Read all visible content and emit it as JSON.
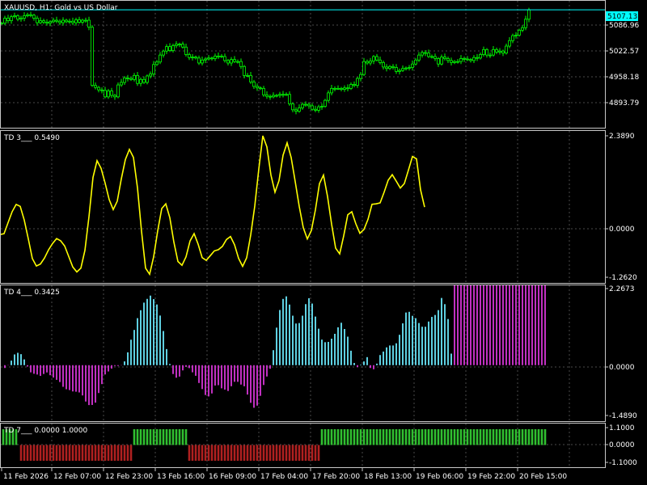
{
  "main_panel": {
    "label": "XAUUSD, H1:  Gold vs US Dollar",
    "price_labels": [
      "5086.96",
      "5022.57",
      "4958.18",
      "4893.79"
    ],
    "current_price": "5107.13",
    "current_price_color": "#00ffff",
    "candle_color": "#00ff00"
  },
  "td3_panel": {
    "label": "TD 3___  0.5490",
    "scale_labels": [
      "2.3890",
      "0.0000",
      "-1.2620"
    ],
    "line_color": "#ffff00"
  },
  "td4_panel": {
    "label": "TD 4___  0.3425",
    "scale_labels": [
      "2.2673",
      "0.0000",
      "-1.4890"
    ],
    "positive_color": "#5ecfe0",
    "negative_color": "#c030c0"
  },
  "td7_panel": {
    "label": "TD 7___  0.0000 1.0000",
    "scale_labels": [
      "1.1000",
      "0.0000",
      "-1.1000"
    ],
    "positive_color": "#30c030",
    "negative_color": "#b02020"
  },
  "time_labels": [
    "11 Feb 2026",
    "12 Feb 07:00",
    "12 Feb 23:00",
    "13 Feb 16:00",
    "16 Feb 09:00",
    "17 Feb 04:00",
    "17 Feb 20:00",
    "18 Feb 13:00",
    "19 Feb 06:00",
    "19 Feb 22:00",
    "20 Feb 15:00"
  ],
  "chart_data": {
    "type": "line",
    "symbol": "XAUUSD",
    "timeframe": "H1",
    "price_ylim": [
      4870,
      5125
    ],
    "price": {
      "x": [
        2,
        6,
        10,
        14,
        18,
        22,
        26,
        30,
        34,
        38,
        42,
        46,
        50,
        54,
        58,
        62,
        66,
        70,
        74,
        78,
        82,
        86,
        90,
        94,
        98,
        102,
        106,
        110,
        114,
        118,
        122,
        126,
        130,
        134,
        138,
        142,
        146,
        150,
        154,
        158,
        162,
        166,
        170,
        174,
        178,
        182,
        186,
        190,
        194,
        198,
        202,
        206,
        210,
        214,
        218,
        222,
        226,
        230,
        234,
        238,
        242,
        246,
        250,
        254,
        258,
        262,
        266,
        270,
        274,
        278,
        282,
        286,
        290,
        294,
        298,
        302,
        306,
        310,
        314,
        318,
        322,
        326,
        330,
        334,
        338,
        342,
        346,
        350,
        354,
        358,
        362,
        366,
        370,
        374,
        378,
        382,
        386,
        390,
        394,
        398,
        402,
        406,
        410,
        414,
        418,
        422,
        426,
        430,
        434,
        438,
        442,
        446,
        450,
        454,
        458,
        462,
        466,
        470,
        474,
        478,
        482,
        486,
        490,
        494,
        498,
        502,
        506,
        510,
        514,
        518,
        522,
        526,
        530,
        534,
        538,
        542,
        546,
        550,
        554,
        558,
        562,
        566,
        570,
        574,
        578,
        582,
        586,
        590,
        594,
        598,
        602,
        606,
        610,
        614,
        618,
        622,
        626,
        630,
        634,
        638,
        642,
        646,
        650,
        654,
        658,
        662,
        666,
        670,
        674
      ],
      "y": [
        5080,
        5090,
        5085,
        5093,
        5095,
        5088,
        5090,
        5095,
        5097,
        5096,
        5090,
        5081,
        5085,
        5082,
        5080,
        5083,
        5086,
        5084,
        5081,
        5086,
        5083,
        5084,
        5081,
        5087,
        5082,
        5086,
        5086,
        5072,
        4955,
        4951,
        4946,
        4945,
        4932,
        4944,
        4935,
        4932,
        4956,
        4961,
        4970,
        4969,
        4967,
        4975,
        4959,
        4967,
        4961,
        4974,
        4978,
        4997,
        5002,
        5016,
        5024,
        5033,
        5025,
        5035,
        5038,
        5038,
        5032,
        5017,
        5011,
        5012,
        5010,
        5000,
        5006,
        5008,
        5010,
        5009,
        5014,
        5014,
        5013,
        5005,
        5000,
        5007,
        5003,
        5003,
        4993,
        4975,
        4975,
        4962,
        4953,
        4950,
        4949,
        4936,
        4933,
        4932,
        4935,
        4935,
        4937,
        4937,
        4937,
        4918,
        4906,
        4903,
        4910,
        4917,
        4917,
        4914,
        4907,
        4905,
        4912,
        4913,
        4925,
        4940,
        4949,
        4949,
        4949,
        4947,
        4950,
        4949,
        4957,
        4955,
        4969,
        4977,
        5003,
        5000,
        5004,
        5013,
        5006,
        5001,
        4992,
        4989,
        4993,
        4991,
        4983,
        4985,
        4989,
        4990,
        4991,
        4998,
        5006,
        5016,
        5021,
        5020,
        5013,
        5013,
        5009,
        4998,
        5012,
        5009,
        5005,
        5001,
        5003,
        5003,
        5009,
        5008,
        5007,
        5005,
        5011,
        5010,
        5017,
        5027,
        5016,
        5016,
        5027,
        5022,
        5024,
        5020,
        5034,
        5045,
        5055,
        5056,
        5066,
        5071,
        5088,
        5107
      ]
    },
    "td3": {
      "ylim": [
        -1.262,
        2.389
      ],
      "x": [
        0,
        5,
        10,
        15,
        20,
        25,
        30,
        35,
        40,
        45,
        50,
        55,
        60,
        65,
        70,
        75,
        80,
        85,
        90,
        95,
        100,
        105,
        110,
        115,
        120,
        125,
        130,
        135,
        140,
        145,
        150,
        155,
        160,
        165,
        170,
        175,
        180,
        185,
        190,
        195,
        200,
        205,
        210,
        215,
        220,
        225,
        230,
        235,
        240,
        245,
        250,
        255,
        260,
        265,
        270,
        275,
        280,
        285,
        290,
        295,
        300,
        305,
        310,
        315,
        320,
        325,
        330,
        335,
        340,
        345,
        350,
        355,
        360,
        365,
        370,
        375,
        380,
        385,
        390,
        395,
        400,
        405,
        410,
        415,
        420,
        425,
        430,
        435,
        440,
        445,
        450,
        455,
        460,
        465,
        470,
        475,
        480,
        485,
        490,
        495,
        500,
        505,
        510,
        515,
        520,
        525,
        530,
        535,
        540,
        545,
        550,
        555,
        560,
        565,
        570,
        575,
        580,
        585,
        590,
        595,
        600,
        605,
        610,
        615,
        620,
        625,
        630,
        635,
        640,
        645,
        650,
        655,
        660,
        665,
        670,
        675
      ],
      "y": [
        -0.16,
        -0.138,
        0.148,
        0.429,
        0.617,
        0.568,
        0.213,
        -0.27,
        -0.781,
        -0.972,
        -0.919,
        -0.766,
        -0.555,
        -0.39,
        -0.263,
        -0.322,
        -0.456,
        -0.728,
        -0.996,
        -1.125,
        -1.027,
        -0.568,
        0.299,
        1.316,
        1.747,
        1.549,
        1.166,
        0.743,
        0.484,
        0.703,
        1.277,
        1.776,
        2.039,
        1.83,
        1.044,
        -0.077,
        -1.026,
        -1.185,
        -0.733,
        -0.062,
        0.511,
        0.633,
        0.274,
        -0.357,
        -0.855,
        -0.954,
        -0.734,
        -0.326,
        -0.136,
        -0.408,
        -0.758,
        -0.826,
        -0.706,
        -0.581,
        -0.551,
        -0.465,
        -0.288,
        -0.211,
        -0.424,
        -0.774,
        -0.981,
        -0.759,
        -0.169,
        0.573,
        1.532,
        2.389,
        2.103,
        1.378,
        0.932,
        1.233,
        1.889,
        2.207,
        1.829,
        1.21,
        0.566,
        0.017,
        -0.273,
        -0.055,
        0.479,
        1.154,
        1.376,
        0.823,
        0.108,
        -0.509,
        -0.659,
        -0.191,
        0.351,
        0.429,
        0.117,
        -0.127,
        -0.029,
        0.231,
        0.621,
        0.632,
        0.658,
        0.936,
        1.244,
        1.385,
        1.216,
        1.039,
        1.159,
        1.502,
        1.854,
        1.795,
        0.998,
        0.549
      ]
    },
    "td4": {
      "ylim": [
        -1.489,
        2.2673
      ],
      "x": [
        6,
        10,
        14,
        18,
        22,
        26,
        30,
        34,
        38,
        42,
        46,
        50,
        54,
        58,
        62,
        66,
        70,
        74,
        78,
        82,
        86,
        90,
        94,
        98,
        102,
        106,
        110,
        114,
        118,
        122,
        126,
        130,
        134,
        138,
        142,
        146,
        150,
        154,
        158,
        162,
        166,
        170,
        174,
        178,
        182,
        186,
        190,
        194,
        198,
        202,
        206,
        210,
        214,
        218,
        222,
        226,
        230,
        234,
        238,
        242,
        246,
        250,
        254,
        258,
        262,
        266,
        270,
        274,
        278,
        282,
        286,
        290,
        294,
        298,
        302,
        306,
        310,
        314,
        318,
        322,
        326,
        330,
        334,
        338,
        342,
        346,
        350,
        354,
        358,
        362,
        366,
        370,
        374,
        378,
        382,
        386,
        390,
        394,
        398,
        402,
        406,
        410,
        414,
        418,
        422,
        426,
        430,
        434,
        438,
        442,
        446,
        450,
        454,
        458,
        462,
        466,
        470,
        474,
        478,
        482,
        486,
        490,
        494,
        498,
        502,
        506,
        510,
        514,
        518,
        522,
        526,
        530,
        534,
        538,
        542,
        546,
        550,
        554,
        558,
        562,
        566,
        570,
        574,
        578,
        582,
        586,
        590,
        594,
        598,
        602,
        606,
        610,
        614,
        618,
        622,
        626,
        630,
        634,
        638,
        642,
        646,
        650,
        654,
        658,
        662,
        666,
        670,
        674
      ],
      "y": [
        -0.083,
        -0.007,
        0.135,
        0.318,
        0.366,
        0.326,
        0.171,
        -0.041,
        -0.212,
        -0.255,
        -0.277,
        -0.318,
        -0.261,
        -0.215,
        -0.297,
        -0.367,
        -0.434,
        -0.499,
        -0.641,
        -0.712,
        -0.737,
        -0.777,
        -0.786,
        -0.807,
        -0.896,
        -1.076,
        -1.181,
        -1.177,
        -1.109,
        -0.824,
        -0.56,
        -0.275,
        -0.186,
        -0.101,
        -0.023,
        -0.023,
        -0.007,
        0.112,
        0.38,
        0.754,
        1.043,
        1.392,
        1.627,
        1.851,
        1.962,
        2.059,
        1.955,
        1.797,
        1.469,
        1.011,
        0.477,
        0.035,
        -0.262,
        -0.371,
        -0.337,
        -0.154,
        -0.05,
        -0.087,
        -0.211,
        -0.314,
        -0.527,
        -0.707,
        -0.883,
        -0.925,
        -0.837,
        -0.602,
        -0.592,
        -0.685,
        -0.723,
        -0.764,
        -0.623,
        -0.492,
        -0.493,
        -0.574,
        -0.624,
        -0.87,
        -1.114,
        -1.26,
        -1.197,
        -0.907,
        -0.586,
        -0.335,
        -0.106,
        0.444,
        1.111,
        1.633,
        1.961,
        2.037,
        1.794,
        1.465,
        1.233,
        1.247,
        1.465,
        1.807,
        1.982,
        1.824,
        1.439,
        1.08,
        0.757,
        0.68,
        0.689,
        0.784,
        0.928,
        1.121,
        1.256,
        1.071,
        0.844,
        0.428,
        0.065,
        -0.057,
        0.015,
        0.11,
        0.238,
        -0.083,
        -0.12,
        0.045,
        0.3,
        0.403,
        0.527,
        0.583,
        0.583,
        0.648,
        0.9,
        1.238,
        1.559,
        1.579,
        1.461,
        1.391,
        1.248,
        1.138,
        1.138,
        1.292,
        1.429,
        1.486,
        1.63,
        1.989,
        1.806,
        1.366,
        0.342
      ]
    },
    "td7": {
      "ylim": [
        -1.1,
        1.1
      ],
      "segments": [
        {
          "x_start": 4,
          "x_end": 22,
          "value": 1
        },
        {
          "x_start": 26,
          "x_end": 162,
          "value": -1
        },
        {
          "x_start": 166,
          "x_end": 230,
          "value": 1
        },
        {
          "x_start": 234,
          "x_end": 394,
          "value": -1
        },
        {
          "x_start": 398,
          "x_end": 674,
          "value": 1
        }
      ]
    }
  }
}
